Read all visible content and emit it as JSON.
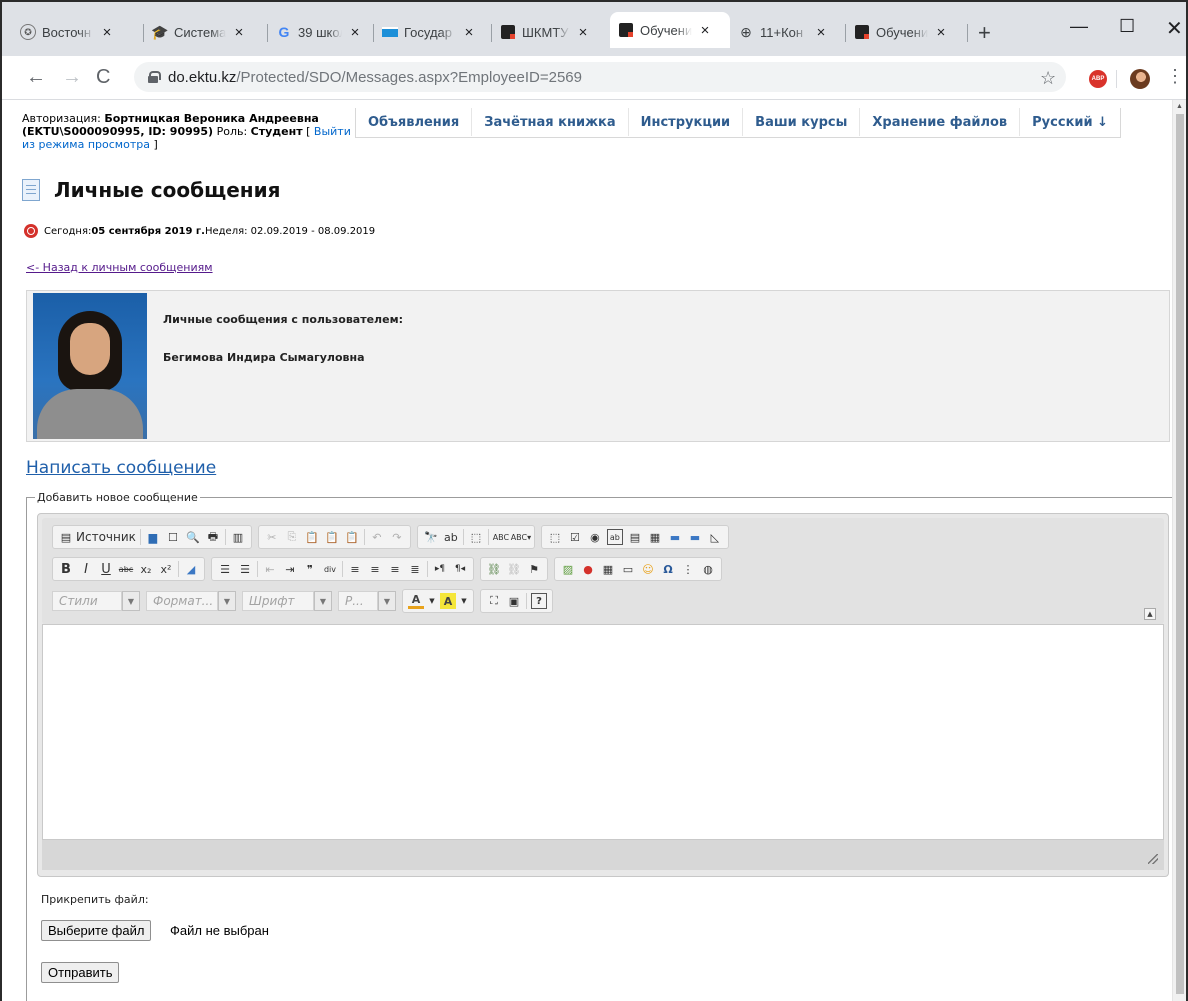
{
  "browser": {
    "tabs": [
      {
        "title": "Восточн",
        "icon": "university-icon",
        "active": false
      },
      {
        "title": "Система",
        "icon": "graduation-cap-icon",
        "active": false
      },
      {
        "title": "39 школ",
        "icon": "google-icon",
        "active": false
      },
      {
        "title": "Государ",
        "icon": "kazakhstan-flag-icon",
        "active": false
      },
      {
        "title": "ШКМТУ",
        "icon": "platonus-icon",
        "active": false
      },
      {
        "title": "Обучени",
        "icon": "platonus-icon",
        "active": true
      },
      {
        "title": "11+Кон",
        "icon": "globe-icon",
        "active": false
      },
      {
        "title": "Обучени",
        "icon": "platonus-icon",
        "active": false
      }
    ],
    "url_host": "do.ektu.kz",
    "url_path": "/Protected/SDO/Messages.aspx?EmployeeID=2569",
    "abp_label": "ABP"
  },
  "header": {
    "auth_prefix": "Авторизация: ",
    "user_name": "Бортницкая Вероника Андреевна (EKTU\\S000090995, ID: 90995)",
    "role_prefix": " Роль: ",
    "role": "Студент",
    "bracket_open": " [ ",
    "exit_link": "Выйти из режима просмотра",
    "bracket_close": " ]"
  },
  "menu": [
    "Объявления",
    "Зачётная книжка",
    "Инструкции",
    "Ваши курсы",
    "Хранение файлов",
    "Русский ↓"
  ],
  "page": {
    "title": "Личные сообщения",
    "today_prefix": "Сегодня: ",
    "today_date": "05 сентября 2019 г.",
    "week_text": " Неделя: 02.09.2019 - 08.09.2019",
    "back_link": "<- Назад к личным сообщениям",
    "user_box_label": "Личные сообщения с пользователем:",
    "user_box_name": "Бегимова Индира Сымагуловна",
    "write_link": "Написать сообщение",
    "legend": "Добавить новое сообщение"
  },
  "editor": {
    "source_label": "Источник",
    "styles_placeholder": "Стили",
    "format_placeholder": "Формат...",
    "font_placeholder": "Шрифт",
    "size_placeholder": "Р..."
  },
  "form": {
    "attach_label": "Прикрепить файл:",
    "choose_file_button": "Выберите файл",
    "no_file_text": "Файл не выбран",
    "send_button": "Отправить"
  },
  "colors": {
    "menu_text": "#2f5c8e",
    "link": "#0066cc",
    "visited_link": "#551a8b",
    "clock_red": "#d4312b"
  }
}
